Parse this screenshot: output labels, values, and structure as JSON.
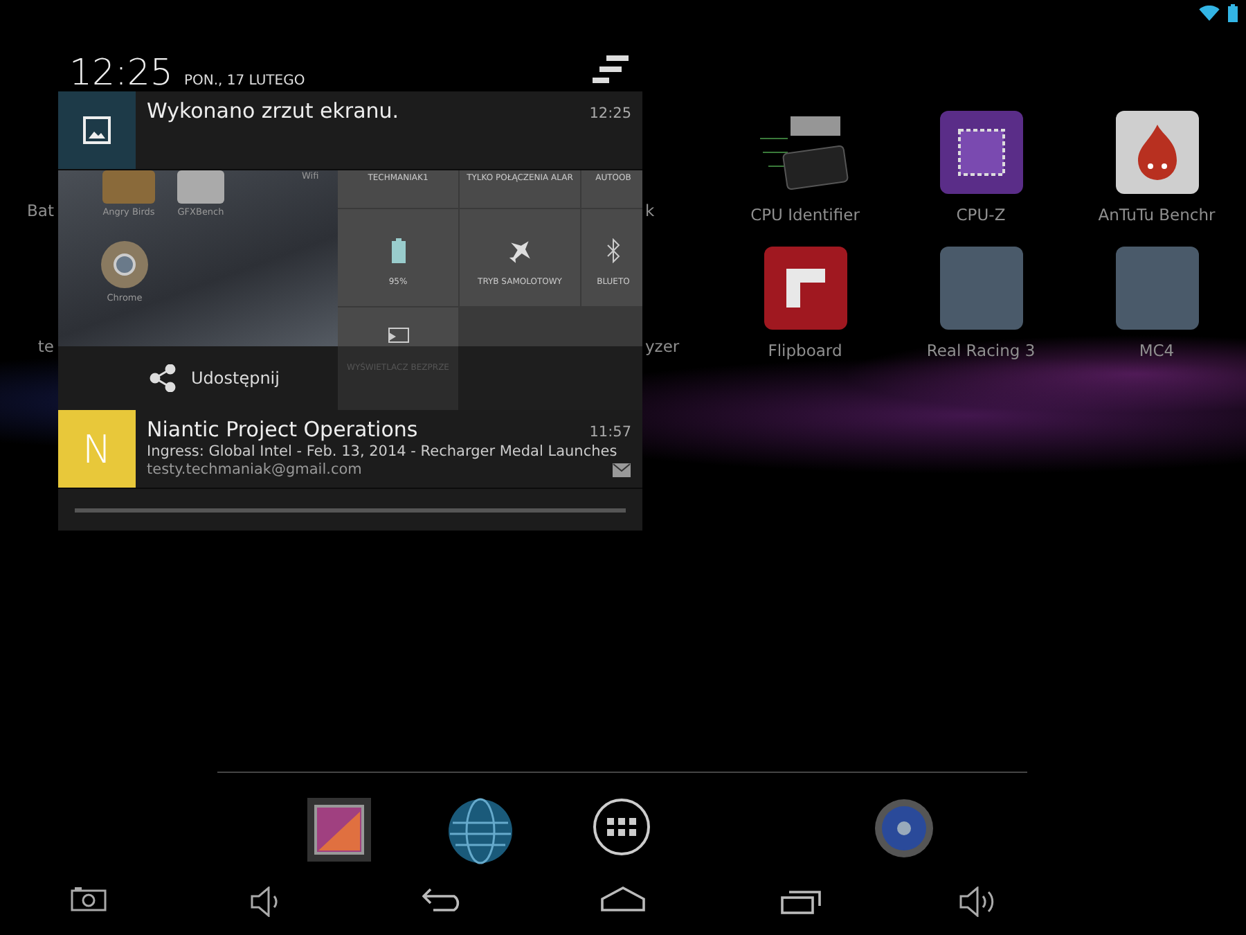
{
  "home_screen": {
    "apps": [
      {
        "label": "Bat",
        "kind": "partial"
      },
      {
        "label": "k",
        "kind": "partial"
      },
      {
        "label": "CPU Identifier",
        "kind": "chip"
      },
      {
        "label": "CPU-Z",
        "kind": "cpuz"
      },
      {
        "label": "AnTuTu Benchr",
        "kind": "flame"
      },
      {
        "label": "te",
        "kind": "partial"
      },
      {
        "label": "yzer",
        "kind": "partial"
      },
      {
        "label": "Flipboard",
        "kind": "flip"
      },
      {
        "label": "Real Racing 3",
        "kind": "photo"
      },
      {
        "label": "MC4",
        "kind": "photo"
      }
    ]
  },
  "notification_panel": {
    "time": "12:25",
    "date": "PON., 17 LUTEGO",
    "notifications": [
      {
        "kind": "screenshot",
        "title": "Wykonano zrzut ekranu.",
        "time": "12:25",
        "preview": {
          "apps": [
            "Angry Birds",
            "GFXBench",
            "Wifi",
            "Chrome"
          ],
          "tiles": [
            "TECHMANIAK1",
            "TYLKO POŁĄCZENIA ALAR",
            "AUTOOB",
            "95%",
            "TRYB SAMOLOTOWY",
            "BLUETO"
          ],
          "cast_label": "WYŚWIETLACZ BEZPRZE"
        },
        "action": "Udostępnij"
      },
      {
        "kind": "email",
        "letter": "N",
        "title": "Niantic Project Operations",
        "text": "Ingress: Global Intel - Feb. 13, 2014 - Recharger Medal Launches",
        "account": "testy.techmaniak@gmail.com",
        "time": "11:57"
      }
    ]
  }
}
